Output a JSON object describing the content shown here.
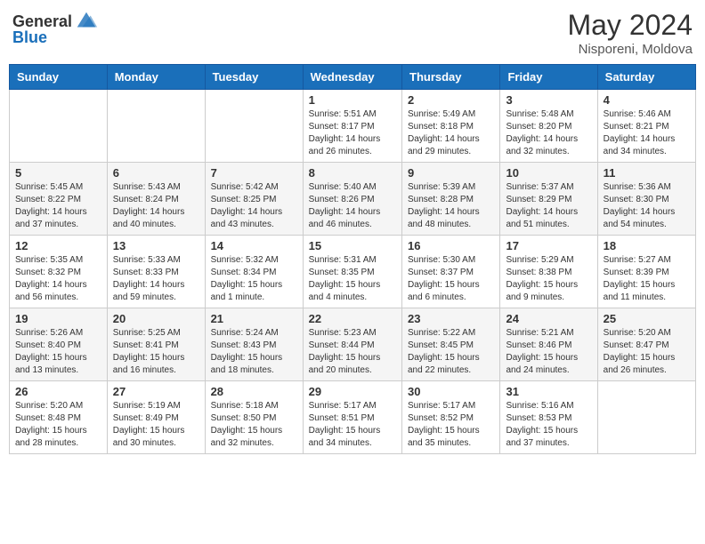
{
  "header": {
    "logo_general": "General",
    "logo_blue": "Blue",
    "month_title": "May 2024",
    "subtitle": "Nisporeni, Moldova"
  },
  "days_of_week": [
    "Sunday",
    "Monday",
    "Tuesday",
    "Wednesday",
    "Thursday",
    "Friday",
    "Saturday"
  ],
  "weeks": [
    [
      {
        "day": "",
        "info": ""
      },
      {
        "day": "",
        "info": ""
      },
      {
        "day": "",
        "info": ""
      },
      {
        "day": "1",
        "info": "Sunrise: 5:51 AM\nSunset: 8:17 PM\nDaylight: 14 hours and 26 minutes."
      },
      {
        "day": "2",
        "info": "Sunrise: 5:49 AM\nSunset: 8:18 PM\nDaylight: 14 hours and 29 minutes."
      },
      {
        "day": "3",
        "info": "Sunrise: 5:48 AM\nSunset: 8:20 PM\nDaylight: 14 hours and 32 minutes."
      },
      {
        "day": "4",
        "info": "Sunrise: 5:46 AM\nSunset: 8:21 PM\nDaylight: 14 hours and 34 minutes."
      }
    ],
    [
      {
        "day": "5",
        "info": "Sunrise: 5:45 AM\nSunset: 8:22 PM\nDaylight: 14 hours and 37 minutes."
      },
      {
        "day": "6",
        "info": "Sunrise: 5:43 AM\nSunset: 8:24 PM\nDaylight: 14 hours and 40 minutes."
      },
      {
        "day": "7",
        "info": "Sunrise: 5:42 AM\nSunset: 8:25 PM\nDaylight: 14 hours and 43 minutes."
      },
      {
        "day": "8",
        "info": "Sunrise: 5:40 AM\nSunset: 8:26 PM\nDaylight: 14 hours and 46 minutes."
      },
      {
        "day": "9",
        "info": "Sunrise: 5:39 AM\nSunset: 8:28 PM\nDaylight: 14 hours and 48 minutes."
      },
      {
        "day": "10",
        "info": "Sunrise: 5:37 AM\nSunset: 8:29 PM\nDaylight: 14 hours and 51 minutes."
      },
      {
        "day": "11",
        "info": "Sunrise: 5:36 AM\nSunset: 8:30 PM\nDaylight: 14 hours and 54 minutes."
      }
    ],
    [
      {
        "day": "12",
        "info": "Sunrise: 5:35 AM\nSunset: 8:32 PM\nDaylight: 14 hours and 56 minutes."
      },
      {
        "day": "13",
        "info": "Sunrise: 5:33 AM\nSunset: 8:33 PM\nDaylight: 14 hours and 59 minutes."
      },
      {
        "day": "14",
        "info": "Sunrise: 5:32 AM\nSunset: 8:34 PM\nDaylight: 15 hours and 1 minute."
      },
      {
        "day": "15",
        "info": "Sunrise: 5:31 AM\nSunset: 8:35 PM\nDaylight: 15 hours and 4 minutes."
      },
      {
        "day": "16",
        "info": "Sunrise: 5:30 AM\nSunset: 8:37 PM\nDaylight: 15 hours and 6 minutes."
      },
      {
        "day": "17",
        "info": "Sunrise: 5:29 AM\nSunset: 8:38 PM\nDaylight: 15 hours and 9 minutes."
      },
      {
        "day": "18",
        "info": "Sunrise: 5:27 AM\nSunset: 8:39 PM\nDaylight: 15 hours and 11 minutes."
      }
    ],
    [
      {
        "day": "19",
        "info": "Sunrise: 5:26 AM\nSunset: 8:40 PM\nDaylight: 15 hours and 13 minutes."
      },
      {
        "day": "20",
        "info": "Sunrise: 5:25 AM\nSunset: 8:41 PM\nDaylight: 15 hours and 16 minutes."
      },
      {
        "day": "21",
        "info": "Sunrise: 5:24 AM\nSunset: 8:43 PM\nDaylight: 15 hours and 18 minutes."
      },
      {
        "day": "22",
        "info": "Sunrise: 5:23 AM\nSunset: 8:44 PM\nDaylight: 15 hours and 20 minutes."
      },
      {
        "day": "23",
        "info": "Sunrise: 5:22 AM\nSunset: 8:45 PM\nDaylight: 15 hours and 22 minutes."
      },
      {
        "day": "24",
        "info": "Sunrise: 5:21 AM\nSunset: 8:46 PM\nDaylight: 15 hours and 24 minutes."
      },
      {
        "day": "25",
        "info": "Sunrise: 5:20 AM\nSunset: 8:47 PM\nDaylight: 15 hours and 26 minutes."
      }
    ],
    [
      {
        "day": "26",
        "info": "Sunrise: 5:20 AM\nSunset: 8:48 PM\nDaylight: 15 hours and 28 minutes."
      },
      {
        "day": "27",
        "info": "Sunrise: 5:19 AM\nSunset: 8:49 PM\nDaylight: 15 hours and 30 minutes."
      },
      {
        "day": "28",
        "info": "Sunrise: 5:18 AM\nSunset: 8:50 PM\nDaylight: 15 hours and 32 minutes."
      },
      {
        "day": "29",
        "info": "Sunrise: 5:17 AM\nSunset: 8:51 PM\nDaylight: 15 hours and 34 minutes."
      },
      {
        "day": "30",
        "info": "Sunrise: 5:17 AM\nSunset: 8:52 PM\nDaylight: 15 hours and 35 minutes."
      },
      {
        "day": "31",
        "info": "Sunrise: 5:16 AM\nSunset: 8:53 PM\nDaylight: 15 hours and 37 minutes."
      },
      {
        "day": "",
        "info": ""
      }
    ]
  ]
}
